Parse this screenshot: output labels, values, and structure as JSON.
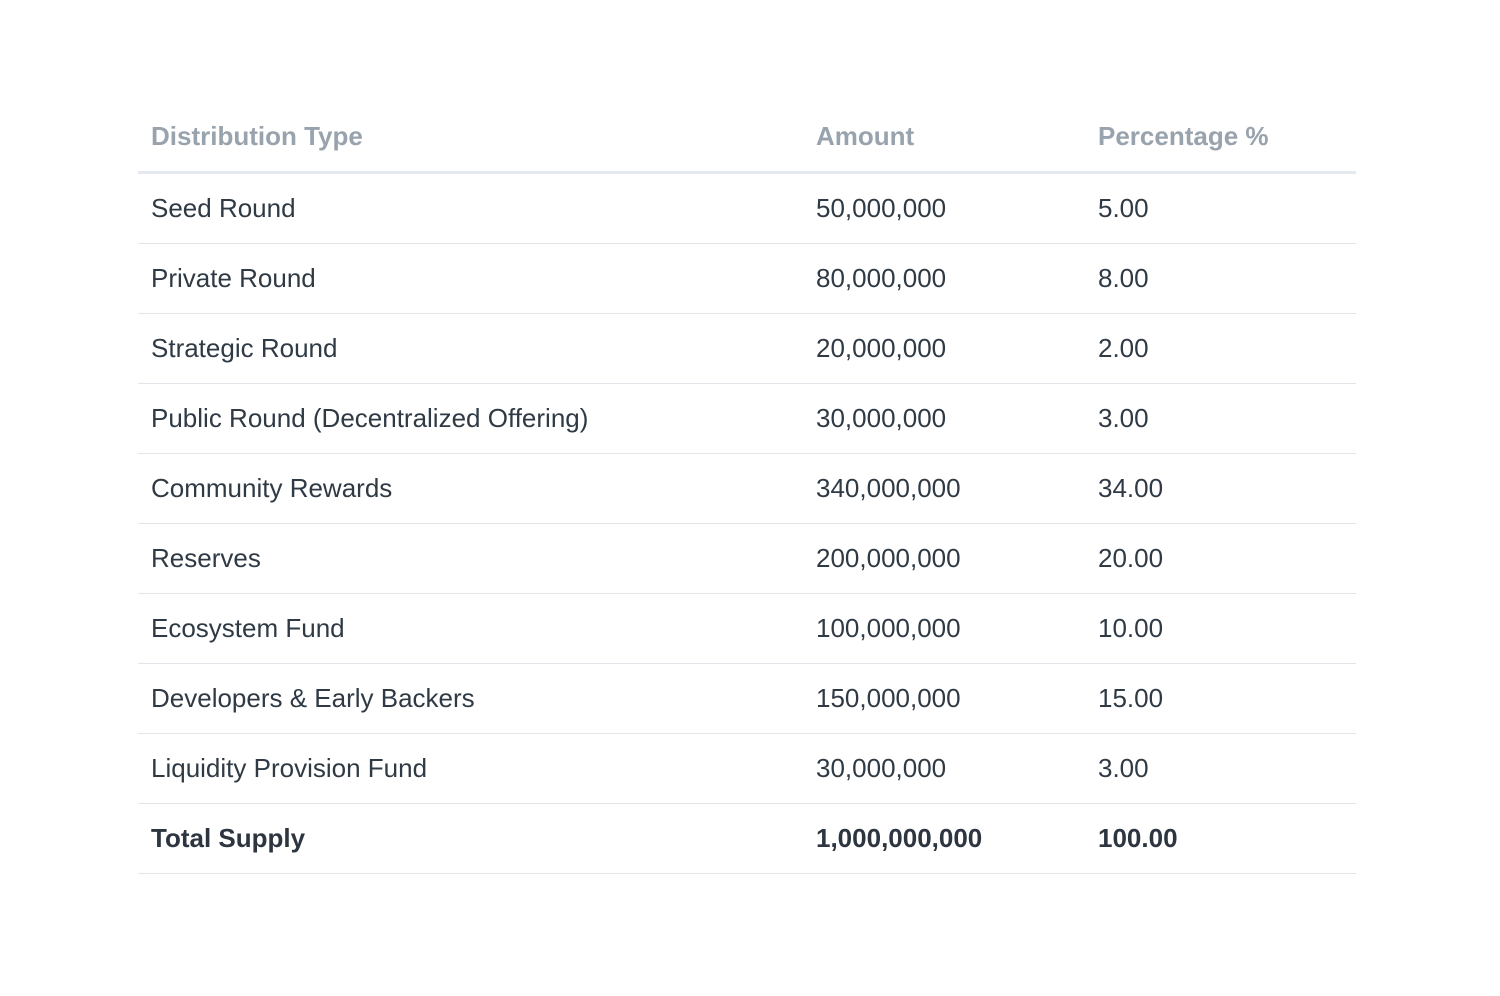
{
  "table": {
    "headers": [
      "Distribution Type",
      "Amount",
      "Percentage %"
    ],
    "rows": [
      [
        "Seed Round",
        "50,000,000",
        "5.00"
      ],
      [
        "Private Round",
        "80,000,000",
        "8.00"
      ],
      [
        "Strategic Round",
        "20,000,000",
        "2.00"
      ],
      [
        "Public Round (Decentralized Offering)",
        "30,000,000",
        "3.00"
      ],
      [
        "Community Rewards",
        "340,000,000",
        "34.00"
      ],
      [
        "Reserves",
        "200,000,000",
        "20.00"
      ],
      [
        "Ecosystem Fund",
        "100,000,000",
        "10.00"
      ],
      [
        "Developers & Early Backers",
        "150,000,000",
        "15.00"
      ],
      [
        "Liquidity Provision Fund",
        "30,000,000",
        "3.00"
      ]
    ],
    "total": [
      "Total Supply",
      "1,000,000,000",
      "100.00"
    ]
  },
  "colors": {
    "header_text": "#98a3ad",
    "body_text": "#2f3a45",
    "row_border": "#e2e6ea"
  }
}
